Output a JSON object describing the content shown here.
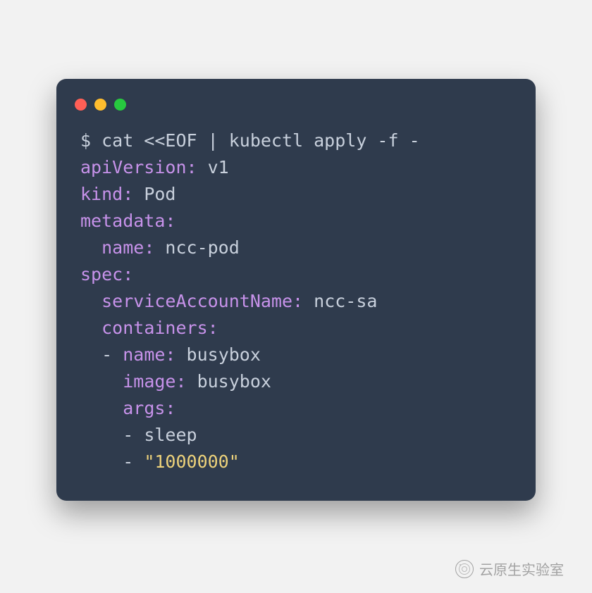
{
  "window": {
    "dots": [
      "red",
      "yellow",
      "green"
    ]
  },
  "code": {
    "cmd": "$ cat <<EOF | kubectl apply -f -",
    "apiVersion_key": "apiVersion:",
    "apiVersion_val": " v1",
    "kind_key": "kind:",
    "kind_val": " Pod",
    "metadata_key": "metadata:",
    "metadata_name_key": "name:",
    "metadata_name_val": " ncc-pod",
    "spec_key": "spec:",
    "serviceAccountName_key": "serviceAccountName:",
    "serviceAccountName_val": " ncc-sa",
    "containers_key": "containers:",
    "dash": "- ",
    "c_name_key": "name:",
    "c_name_val": " busybox",
    "c_image_key": "image:",
    "c_image_val": " busybox",
    "c_args_key": "args:",
    "arg1": "sleep",
    "arg2": "\"1000000\""
  },
  "watermark": {
    "text": "云原生实验室"
  },
  "colors": {
    "bg": "#2f3b4d",
    "text": "#c8d0dc",
    "key": "#c792ea",
    "string": "#edd27b",
    "red": "#ff5f56",
    "yellow": "#ffbd2e",
    "green": "#27c93f"
  }
}
